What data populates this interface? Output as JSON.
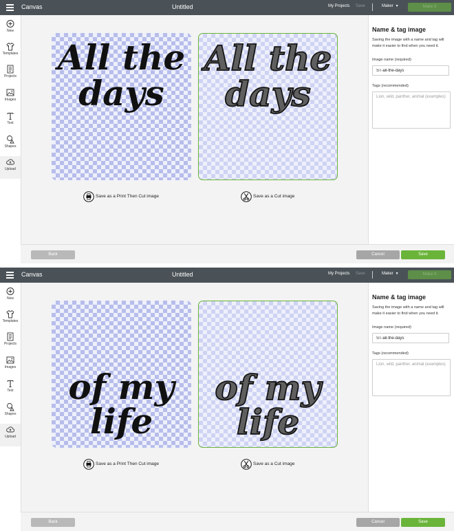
{
  "topbar": {
    "menu_icon": "hamburger-menu-icon",
    "title": "Canvas",
    "document_title": "Untitled",
    "my_projects": "My Projects",
    "save": "Save",
    "machine": "Maker",
    "make_it": "Make It"
  },
  "sidebar": {
    "items": [
      {
        "label": "New",
        "icon": "plus-circle-icon"
      },
      {
        "label": "Templates",
        "icon": "shirt-icon"
      },
      {
        "label": "Projects",
        "icon": "projects-icon"
      },
      {
        "label": "Images",
        "icon": "image-icon"
      },
      {
        "label": "Text",
        "icon": "text-icon"
      },
      {
        "label": "Shapes",
        "icon": "shapes-icon"
      },
      {
        "label": "Upload",
        "icon": "cloud-upload-icon"
      }
    ]
  },
  "panel": {
    "title": "Name & tag image",
    "description": "Saving the image with a name and tag will make it easier to find when you need it.",
    "name_label": "Image name (required)",
    "name_value": "ST-all-the-days",
    "tags_label": "Tags (recommended)",
    "tags_placeholder": "Lion, wild, panther, animal (examples)"
  },
  "options": {
    "print_then_cut": "Save as a Print Then Cut image",
    "print_icon": "printer-icon",
    "cut": "Save as a Cut image",
    "cut_icon": "scissors-icon"
  },
  "buttons": {
    "back": "Back",
    "cancel": "Cancel",
    "save": "Save"
  },
  "colors": {
    "topbar": "#4a5257",
    "accent_green": "#6ab43a",
    "checker": "#b7bdeb"
  },
  "frames": [
    {
      "artwork_lines": [
        "All the",
        "days"
      ]
    },
    {
      "artwork_lines": [
        "of my",
        "life"
      ]
    }
  ]
}
